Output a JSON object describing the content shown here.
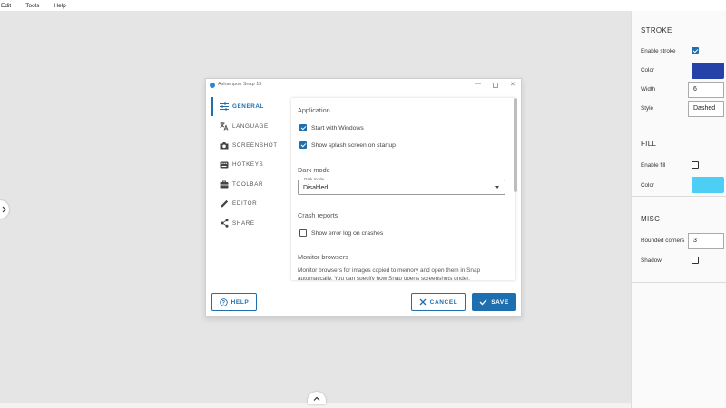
{
  "menu": {
    "items": [
      "Edit",
      "Tools",
      "Help"
    ]
  },
  "dialog": {
    "title": "Ashampoo Snap 15",
    "nav": [
      {
        "label": "GENERAL",
        "icon": "sliders-icon",
        "active": true
      },
      {
        "label": "LANGUAGE",
        "icon": "translate-icon"
      },
      {
        "label": "SCREENSHOT",
        "icon": "camera-icon"
      },
      {
        "label": "HOTKEYS",
        "icon": "keyboard-icon"
      },
      {
        "label": "TOOLBAR",
        "icon": "toolbox-icon"
      },
      {
        "label": "EDITOR",
        "icon": "pencil-icon"
      },
      {
        "label": "SHARE",
        "icon": "share-icon"
      }
    ],
    "application": {
      "heading": "Application",
      "start_with_windows": "Start with Windows",
      "splash": "Show splash screen on startup"
    },
    "dark_mode": {
      "heading": "Dark mode",
      "legend": "Dark mode",
      "value": "Disabled"
    },
    "crash": {
      "heading": "Crash reports",
      "error_log": "Show error log on crashes"
    },
    "monitor": {
      "heading": "Monitor browsers",
      "description": "Monitor browsers for images copied to memory and open them in Snap automatically. You can specify how Snap opens screenshots under."
    },
    "buttons": {
      "help": "HELP",
      "cancel": "CANCEL",
      "save": "SAVE"
    }
  },
  "panel": {
    "stroke": {
      "title": "STROKE",
      "enable_label": "Enable stroke",
      "color_label": "Color",
      "color": "#2442a8",
      "width_label": "Width",
      "width_value": "6",
      "style_label": "Style",
      "style_value": "Dashed"
    },
    "fill": {
      "title": "FILL",
      "enable_label": "Enable fill",
      "color_label": "Color",
      "color": "#4dcff5"
    },
    "misc": {
      "title": "MISC",
      "rounded_label": "Rounded corners",
      "rounded_value": "3",
      "shadow_label": "Shadow"
    }
  },
  "colors": {
    "accent": "#1e6fb0"
  }
}
